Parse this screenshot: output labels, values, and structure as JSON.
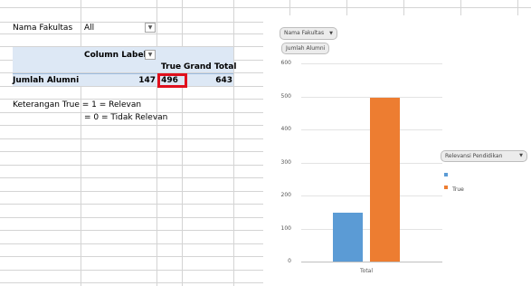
{
  "filter": {
    "label": "Nama Fakultas",
    "value": "All"
  },
  "pivot": {
    "column_labels": "Column Labels",
    "col_headers": [
      "True",
      "Grand Total"
    ],
    "row_label": "Jumlah Alumni",
    "values": [
      "147",
      "496",
      "643"
    ]
  },
  "notes": {
    "line1": "Keterangan True =  1 = Relevan",
    "line2": "= 0 = Tidak Relevan"
  },
  "chart": {
    "filter_button": "Nama Fakultas",
    "value_button": "Jumlah Alumni",
    "legend_button": "Relevansi Pendidikan",
    "legend_entries": [
      "",
      "True"
    ],
    "colors": {
      "blank": "#5b9bd5",
      "true": "#ed7d31",
      "highlight": "#e0101d"
    }
  },
  "chart_data": {
    "type": "bar",
    "categories": [
      "Total"
    ],
    "series": [
      {
        "name": "",
        "values": [
          147
        ]
      },
      {
        "name": "True",
        "values": [
          496
        ]
      }
    ],
    "ylim": [
      0,
      600
    ],
    "yticks": [
      "0",
      "100",
      "200",
      "300",
      "400",
      "500",
      "600"
    ],
    "grid": true,
    "legend": "right"
  }
}
